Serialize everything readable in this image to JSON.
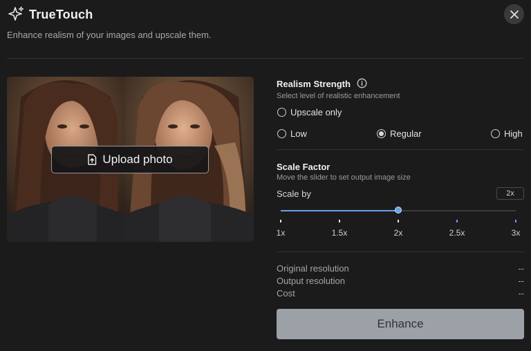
{
  "app": {
    "title": "TrueTouch",
    "subtitle": "Enhance realism of your images and upscale them."
  },
  "preview": {
    "upload_label": "Upload photo"
  },
  "realism": {
    "title": "Realism Strength",
    "subtitle": "Select level of realistic enhancement",
    "options": [
      {
        "label": "Upscale only",
        "checked": false
      },
      {
        "label": "Low",
        "checked": false
      },
      {
        "label": "Regular",
        "checked": true
      },
      {
        "label": "High",
        "checked": false
      }
    ]
  },
  "scale": {
    "title": "Scale Factor",
    "subtitle": "Move the slider to set output image size",
    "label": "Scale by",
    "value_display": "2x",
    "value": 2,
    "min": 1,
    "max": 3,
    "ticks": [
      "1x",
      "1.5x",
      "2x",
      "2.5x",
      "3x"
    ],
    "accent": "#6aa2e6"
  },
  "info": {
    "original_label": "Original resolution",
    "original_value": "--",
    "output_label": "Output resolution",
    "output_value": "--",
    "cost_label": "Cost",
    "cost_value": "--"
  },
  "actions": {
    "enhance_label": "Enhance"
  }
}
